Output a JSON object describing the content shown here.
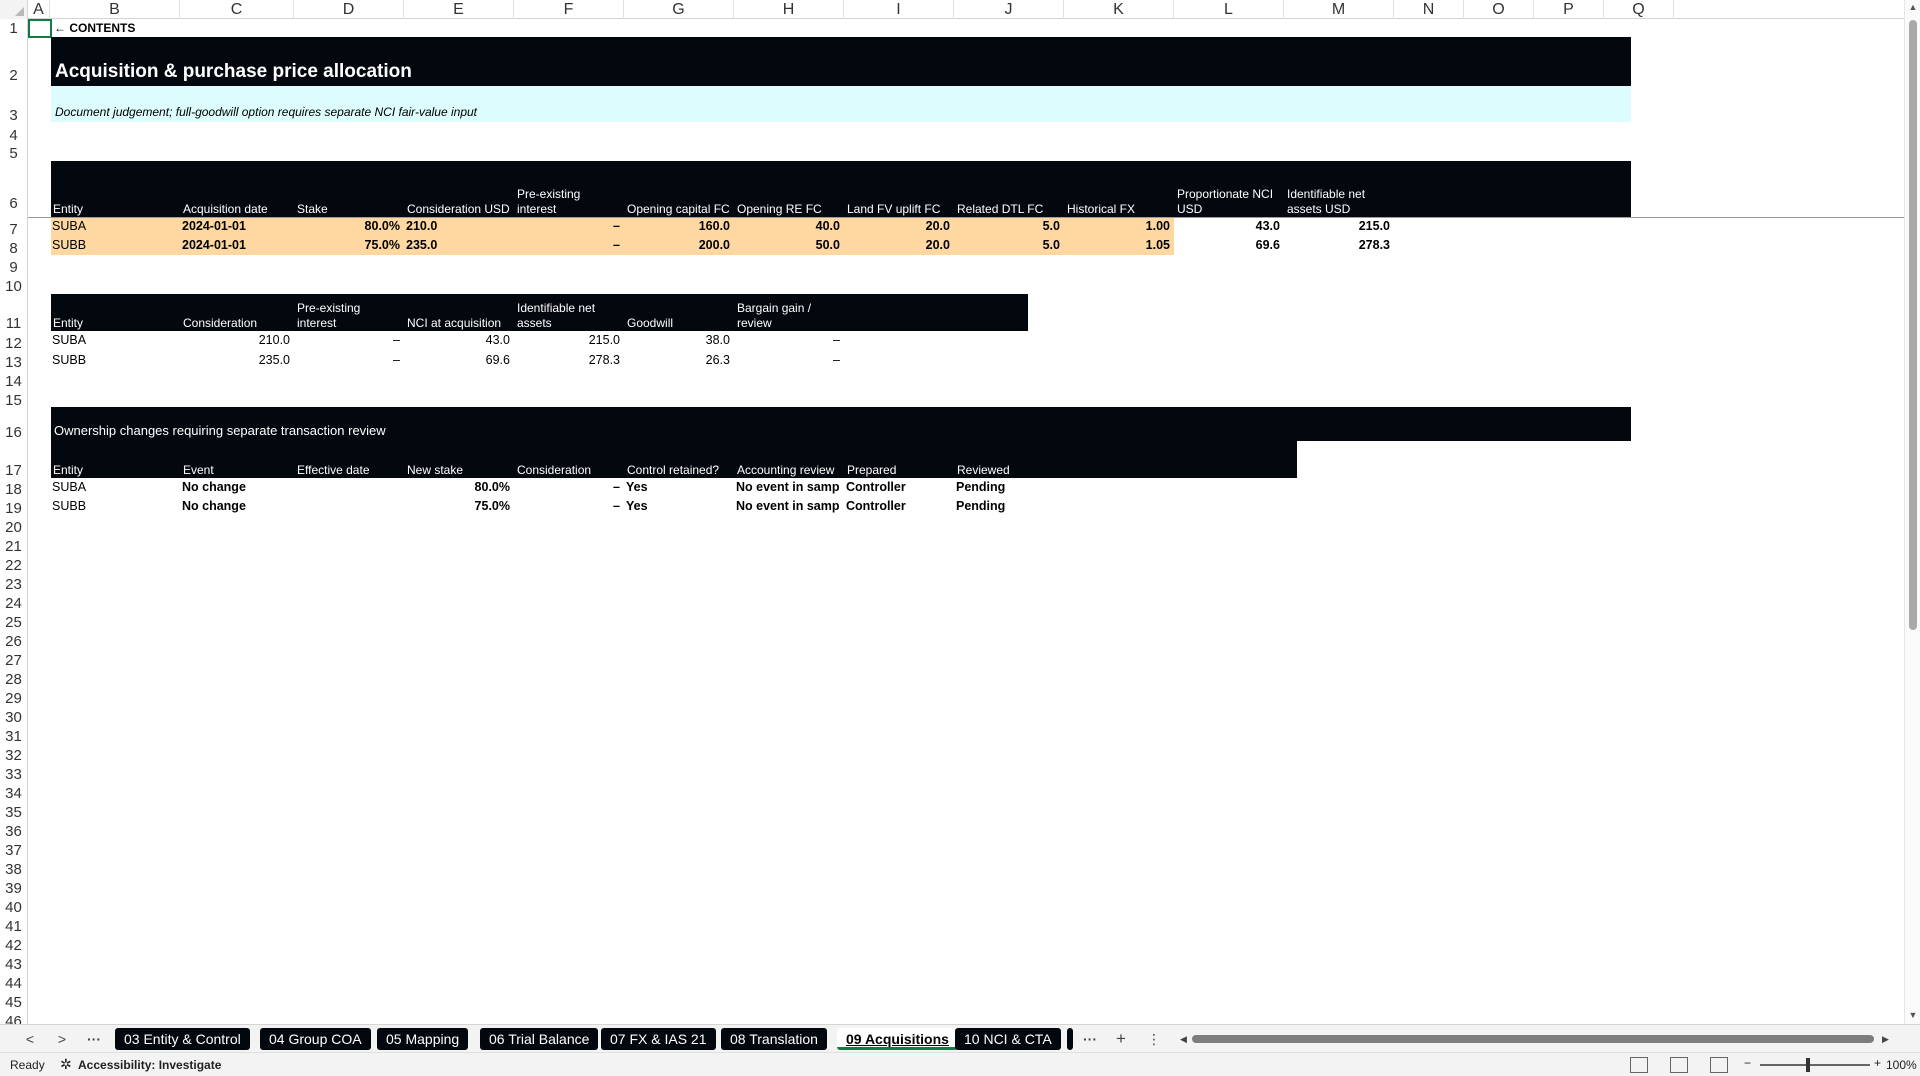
{
  "columns": [
    "A",
    "B",
    "C",
    "D",
    "E",
    "F",
    "G",
    "H",
    "I",
    "J",
    "K",
    "L",
    "M",
    "N",
    "O",
    "P",
    "Q"
  ],
  "rows": [
    "1",
    "2",
    "3",
    "4",
    "5",
    "6",
    "7",
    "8",
    "9",
    "10",
    "11",
    "12",
    "13",
    "14",
    "15",
    "16",
    "17",
    "18",
    "19",
    "20",
    "21",
    "22",
    "23",
    "24",
    "25",
    "26",
    "27",
    "28",
    "29",
    "30",
    "31",
    "32",
    "33",
    "34",
    "35",
    "36",
    "37",
    "38",
    "39",
    "40",
    "41",
    "42",
    "43",
    "44",
    "45",
    "46"
  ],
  "contents_link": "← CONTENTS",
  "title": "Acquisition & purchase price allocation",
  "note": "Document judgement; full-goodwill option requires separate NCI fair-value input",
  "table1": {
    "headers": [
      "Entity",
      "Acquisition date",
      "Stake",
      "Consideration USD",
      "Pre-existing\ninterest",
      "Opening capital FC",
      "Opening RE FC",
      "Land FV uplift FC",
      "Related DTL FC",
      "Historical FX",
      "Proportionate NCI\nUSD",
      "Identifiable net\nassets USD"
    ],
    "rows": [
      [
        "SUBA",
        "2024-01-01",
        "80.0%",
        "210.0",
        "–",
        "160.0",
        "40.0",
        "20.0",
        "5.0",
        "1.00",
        "43.0",
        "215.0"
      ],
      [
        "SUBB",
        "2024-01-01",
        "75.0%",
        "235.0",
        "–",
        "200.0",
        "50.0",
        "20.0",
        "5.0",
        "1.05",
        "69.6",
        "278.3"
      ]
    ]
  },
  "table2": {
    "headers": [
      "Entity",
      "Consideration",
      "Pre-existing\ninterest",
      "NCI at acquisition",
      "Identifiable net\nassets",
      "Goodwill",
      "Bargain gain /\nreview"
    ],
    "rows": [
      [
        "SUBA",
        "210.0",
        "–",
        "43.0",
        "215.0",
        "38.0",
        "–"
      ],
      [
        "SUBB",
        "235.0",
        "–",
        "69.6",
        "278.3",
        "26.3",
        "–"
      ]
    ]
  },
  "table3": {
    "title": "Ownership changes requiring separate transaction review",
    "headers": [
      "Entity",
      "Event",
      "Effective date",
      "New stake",
      "Consideration",
      "Control retained?",
      "Accounting review",
      "Prepared",
      "Reviewed"
    ],
    "rows": [
      [
        "SUBA",
        "No change",
        "",
        "80.0%",
        "–",
        "Yes",
        "No event in sample",
        "Controller",
        "Pending"
      ],
      [
        "SUBB",
        "No change",
        "",
        "75.0%",
        "–",
        "Yes",
        "No event in sample",
        "Controller",
        "Pending"
      ]
    ]
  },
  "tabs": [
    "03 Entity & Control",
    "04 Group COA",
    "05 Mapping",
    "06 Trial Balance",
    "07 FX & IAS 21",
    "08 Translation",
    "09 Acquisitions",
    "10 NCI & CTA"
  ],
  "active_tab": "09 Acquisitions",
  "status": {
    "ready": "Ready",
    "accessibility": "Accessibility: Investigate",
    "zoom": "100%"
  },
  "icons": {
    "prev": "chevron-left",
    "next": "chevron-right",
    "more": "ellipsis",
    "add": "plus",
    "options": "vertical-ellipsis"
  },
  "colors": {
    "header_dark": "#03080f",
    "note_bg": "#dcfcfd",
    "input_bg": "#fed8a0",
    "accent": "#107c41"
  }
}
